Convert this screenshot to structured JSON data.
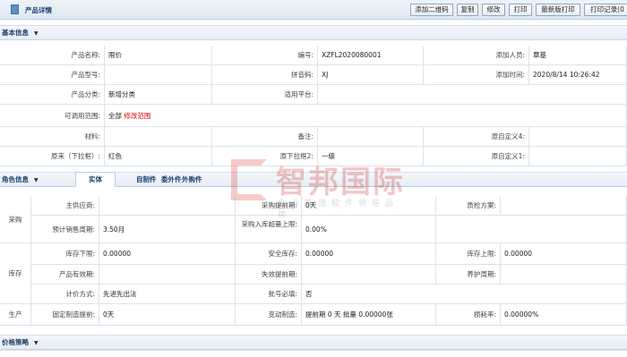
{
  "toolbar": {
    "title": "产品详情",
    "buttons": [
      "添加二维码",
      "复制",
      "修改",
      "打印",
      "最新版打印",
      "打印记录(0"
    ]
  },
  "basic": {
    "section_title": "基本信息",
    "name_label": "产品名称:",
    "name_value": "限价",
    "code_label": "编号:",
    "code_value": "XZFL2020080001",
    "adder_label": "添加人员:",
    "adder_value": "章基",
    "model_label": "产品型号:",
    "pinyin_label": "拼音码:",
    "pinyin_value": "XJ",
    "addtime_label": "添加时间:",
    "addtime_value": "2020/8/14 10:26:42",
    "category_label": "产品分类:",
    "category_value": "新增分类",
    "platform_label": "适用平台:",
    "scope_label": "可调用范围:",
    "scope_value": "全部",
    "scope_edit": "修改范围",
    "material_label": "材料:",
    "remark_label": "备注:",
    "custom4_label": "原自定义4:",
    "dropdown1_label": "原来（下拉框）:",
    "dropdown1_value": "红色",
    "dropdown2_label": "原下拉框2:",
    "dropdown2_value": "一级",
    "custom1_label": "原自定义1:"
  },
  "roles": {
    "section_title": "角色信息",
    "tabs": [
      "实体",
      "自制件",
      "委外件",
      "外购件"
    ],
    "purchase_group": "采购",
    "supplier_label": "主供应商:",
    "lead_label": "采购提前期:",
    "lead_value": "0天",
    "qc_label": "质检方案:",
    "sales_period_label": "预计销售周期:",
    "sales_period_value": "3.50月",
    "over_label": "采购入库超量上限:",
    "over_value": "0.00%",
    "stock_group": "库存",
    "stock_min_label": "库存下限:",
    "stock_min_value": "0.00000",
    "safe_label": "安全库存:",
    "safe_value": "0.00000",
    "stock_max_label": "库存上限:",
    "stock_max_value": "0.00000",
    "valid_label": "产品有效期:",
    "expire_label": "失效提前期:",
    "maint_label": "养护周期:",
    "pricing_label": "计价方式:",
    "pricing_value": "先进先出法",
    "batch_label": "批号必填:",
    "batch_value": "否",
    "prod_group": "生产",
    "fixed_label": "固定制造提前:",
    "fixed_value": "0天",
    "var_label": "变动制造:",
    "var_value": "提前期 0 天 批量 0.00000张",
    "loss_label": "损耗率:",
    "loss_value": "0.00000%"
  },
  "price": {
    "section_title": "价格策略"
  },
  "watermark": {
    "brand": "智邦国际",
    "slogan": "企业管理软件领导品牌",
    "color": "#cc0000"
  }
}
